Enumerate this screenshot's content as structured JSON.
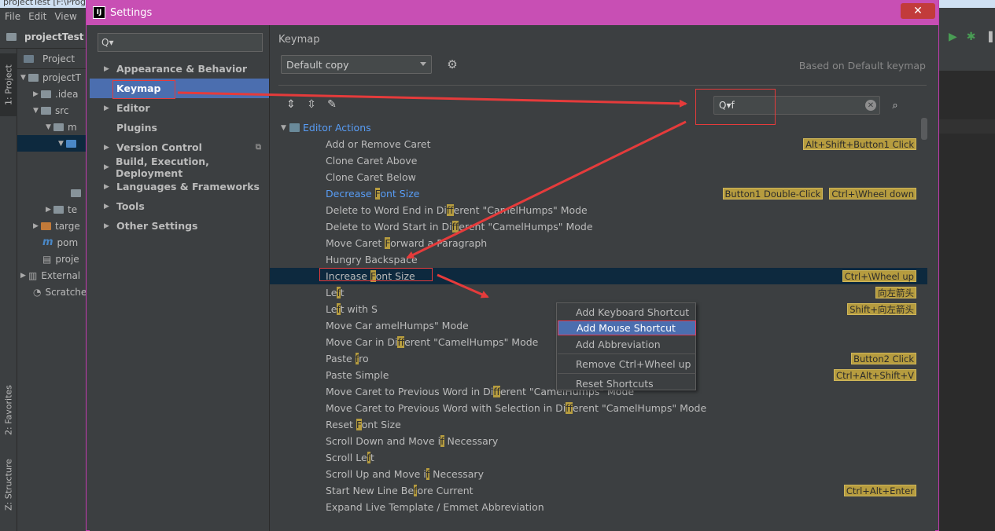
{
  "ide": {
    "title": "projectTest [F:\\Program Files\\IdeaProjects\\projectTest] - ...\\src\\main\\java\\Test.java [projectTest] - IntelliJ IDEA (Administrator)",
    "menu": [
      "File",
      "Edit",
      "View"
    ],
    "toolbar_project": "projectTest",
    "left_tabs": [
      "1: Project",
      "2: Favorites",
      "Z: Structure"
    ],
    "project_header": "Project",
    "tree": [
      {
        "label": "projectT",
        "indent": 4,
        "arrow": "▼",
        "icon": "folder"
      },
      {
        "label": ".idea",
        "indent": 20,
        "arrow": "▶",
        "icon": "folder"
      },
      {
        "label": "src",
        "indent": 20,
        "arrow": "▼",
        "icon": "folder"
      },
      {
        "label": "m",
        "indent": 36,
        "arrow": "▼",
        "icon": "folder"
      },
      {
        "label": "",
        "indent": 52,
        "arrow": "▼",
        "icon": "blue"
      },
      {
        "label": "",
        "indent": 0,
        "arrow": "",
        "icon": ""
      },
      {
        "label": "",
        "indent": 0,
        "arrow": "",
        "icon": ""
      },
      {
        "label": "",
        "indent": 68,
        "arrow": "",
        "icon": "folder"
      },
      {
        "label": "te",
        "indent": 36,
        "arrow": "▶",
        "icon": "folder"
      },
      {
        "label": "targe",
        "indent": 20,
        "arrow": "▶",
        "icon": "orange"
      },
      {
        "label": "pom",
        "indent": 32,
        "arrow": "",
        "icon": "m"
      },
      {
        "label": "proje",
        "indent": 32,
        "arrow": "",
        "icon": "file"
      },
      {
        "label": "External",
        "indent": 4,
        "arrow": "▶",
        "icon": "lib"
      },
      {
        "label": "Scratche",
        "indent": 20,
        "arrow": "",
        "icon": "scratch"
      }
    ]
  },
  "dialog": {
    "title": "Settings",
    "close_label": "✕",
    "search_placeholder": "Q▾",
    "nav": [
      {
        "label": "Appearance & Behavior",
        "arrow": "▶"
      },
      {
        "label": "Keymap",
        "arrow": ""
      },
      {
        "label": "Editor",
        "arrow": "▶"
      },
      {
        "label": "Plugins",
        "arrow": ""
      },
      {
        "label": "Version Control",
        "arrow": "▶"
      },
      {
        "label": "Build, Execution, Deployment",
        "arrow": "▶"
      },
      {
        "label": "Languages & Frameworks",
        "arrow": "▶"
      },
      {
        "label": "Tools",
        "arrow": "▶"
      },
      {
        "label": "Other Settings",
        "arrow": "▶"
      }
    ],
    "selected_nav": "Keymap"
  },
  "keymap": {
    "heading": "Keymap",
    "selected_keymap": "Default copy",
    "based_on": "Based on Default keymap",
    "search_value": "Q▾f",
    "clear_label": "✕",
    "group": "Editor Actions",
    "actions": [
      {
        "parts": [
          [
            "Add or Remove Caret",
            false
          ]
        ],
        "shortcuts": [
          "Alt+Shift+Button1 Click"
        ]
      },
      {
        "parts": [
          [
            "Clone Caret Above",
            false
          ]
        ],
        "shortcuts": []
      },
      {
        "parts": [
          [
            "Clone Caret Below",
            false
          ]
        ],
        "shortcuts": []
      },
      {
        "parts": [
          [
            "Decrease ",
            false
          ],
          [
            "F",
            true
          ],
          [
            "ont Size",
            false
          ]
        ],
        "shortcuts": [
          "Button1 Double-Click",
          "Ctrl+\\Wheel down"
        ],
        "blue": true
      },
      {
        "parts": [
          [
            "Delete to Word End in Di",
            false
          ],
          [
            "f",
            true
          ],
          [
            "ferent \"CamelHumps\" Mode",
            false
          ]
        ],
        "shortcuts": []
      },
      {
        "parts": [
          [
            "Delete to Word Start in Di",
            false
          ],
          [
            "f",
            true
          ],
          [
            "ferent \"CamelHumps\" Mode",
            false
          ]
        ],
        "shortcuts": []
      },
      {
        "parts": [
          [
            "Move Caret ",
            false
          ],
          [
            "F",
            true
          ],
          [
            "orward a Paragraph",
            false
          ]
        ],
        "shortcuts": []
      },
      {
        "parts": [
          [
            "Hungry Backspace",
            false
          ]
        ],
        "shortcuts": []
      },
      {
        "parts": [
          [
            "Increase ",
            false
          ],
          [
            "F",
            true
          ],
          [
            "ont Size",
            false
          ]
        ],
        "shortcuts": [
          "Ctrl+\\Wheel up"
        ],
        "selected": true
      },
      {
        "parts": [
          [
            "Le",
            false
          ],
          [
            "f",
            true
          ],
          [
            "t",
            false
          ]
        ],
        "shortcuts": [
          "向左箭头"
        ]
      },
      {
        "parts": [
          [
            "Le",
            false
          ],
          [
            "f",
            true
          ],
          [
            "t with S",
            false
          ]
        ],
        "shortcuts": [
          "Shift+向左箭头"
        ]
      },
      {
        "parts": [
          [
            "Move Car",
            false
          ],
          [
            "",
            false
          ],
          [
            "                              amelHumps\" Mode",
            false
          ]
        ],
        "shortcuts": []
      },
      {
        "parts": [
          [
            "Move Car",
            false
          ],
          [
            "                                        in Di",
            false
          ],
          [
            "f",
            true
          ],
          [
            "ferent \"CamelHumps\" Mode",
            false
          ]
        ],
        "shortcuts": []
      },
      {
        "parts": [
          [
            "Paste ",
            false
          ],
          [
            "f",
            true
          ],
          [
            "ro",
            false
          ]
        ],
        "shortcuts": [
          "Button2 Click"
        ]
      },
      {
        "parts": [
          [
            "Paste Simple",
            false
          ]
        ],
        "shortcuts": [
          "Ctrl+Alt+Shift+V"
        ]
      },
      {
        "parts": [
          [
            "Move Caret to Previous Word in Di",
            false
          ],
          [
            "f",
            true
          ],
          [
            "ferent \"CamelHumps\" Mode",
            false
          ]
        ],
        "shortcuts": []
      },
      {
        "parts": [
          [
            "Move Caret to Previous Word with Selection in Di",
            false
          ],
          [
            "f",
            true
          ],
          [
            "ferent \"CamelHumps\" Mode",
            false
          ]
        ],
        "shortcuts": []
      },
      {
        "parts": [
          [
            "Reset ",
            false
          ],
          [
            "F",
            true
          ],
          [
            "ont Size",
            false
          ]
        ],
        "shortcuts": []
      },
      {
        "parts": [
          [
            "Scroll Down and Move i",
            false
          ],
          [
            "f",
            true
          ],
          [
            " Necessary",
            false
          ]
        ],
        "shortcuts": []
      },
      {
        "parts": [
          [
            "Scroll Le",
            false
          ],
          [
            "f",
            true
          ],
          [
            "t",
            false
          ]
        ],
        "shortcuts": []
      },
      {
        "parts": [
          [
            "Scroll Up and Move i",
            false
          ],
          [
            "f",
            true
          ],
          [
            " Necessary",
            false
          ]
        ],
        "shortcuts": []
      },
      {
        "parts": [
          [
            "Start New Line Be",
            false
          ],
          [
            "f",
            true
          ],
          [
            "ore Current",
            false
          ]
        ],
        "shortcuts": [
          "Ctrl+Alt+Enter"
        ]
      },
      {
        "parts": [
          [
            "Expand Live Template / Emmet Abbreviation",
            false
          ]
        ],
        "shortcuts": []
      }
    ]
  },
  "context_menu": {
    "items": [
      "Add Keyboard Shortcut",
      "Add Mouse Shortcut",
      "Add Abbreviation",
      "Remove Ctrl+Wheel up",
      "Reset Shortcuts"
    ],
    "active": "Add Mouse Shortcut"
  },
  "colors": {
    "dialog_title": "#c84fb4",
    "selection": "#4b6eaf",
    "highlight": "#b69c3f",
    "annotation": "#e53b3b"
  }
}
